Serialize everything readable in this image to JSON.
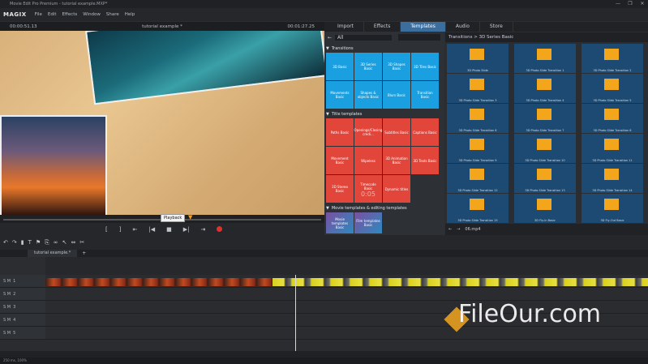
{
  "window": {
    "title": "Movie Edit Pro Premium - tutorial example.MXP*",
    "controls": [
      "—",
      "❐",
      "✕"
    ]
  },
  "menubar": {
    "logo": "MAGIX",
    "items": [
      "File",
      "Edit",
      "Effects",
      "Window",
      "Share",
      "Help"
    ]
  },
  "preview": {
    "timecode_left": "00:00:51.13",
    "title": "tutorial example *",
    "timecode_right": "00:01:27.25",
    "tooltip": "Playback"
  },
  "media_tabs": [
    "Import",
    "Effects",
    "Templates",
    "Audio",
    "Store"
  ],
  "active_tab": "Templates",
  "filter": {
    "value": "All"
  },
  "templates": {
    "transitions_header": "Transitions",
    "transitions": [
      "3D Basic",
      "3D Series Basic",
      "3D Shapes Basic",
      "3D Tiles Basic",
      "Movements Basic",
      "Shapes & objects Basic",
      "Blurs Basic",
      "Transition Basic"
    ],
    "titles_header": "Title templates",
    "titles": [
      "Paths Basic",
      "Openings/Closing credi...",
      "Subtitles Basic",
      "Captions Basic",
      "Movement Basic",
      "Wipeless",
      "3D Animation Basic",
      "3D Texts Basic",
      "3D Stereo Basic",
      "Timecode Basic",
      "Dynamic titles"
    ],
    "titles_timecode": "0:05",
    "movie_header": "Movie templates & editing templates",
    "movie": [
      "Movie templates Basic",
      "Film templates Basic"
    ]
  },
  "right_panel": {
    "header": "Transitions > 3D Series Basic",
    "thumbs": [
      "3D Photo Slide",
      "3D Photo Slide Transition 1",
      "3D Photo Slide Transition 2",
      "3D Photo Slide Transition 3",
      "3D Photo Slide Transition 4",
      "3D Photo Slide Transition 5",
      "3D Photo Slide Transition 6",
      "3D Photo Slide Transition 7",
      "3D Photo Slide Transition 8",
      "3D Photo Slide Transition 9",
      "3D Photo Slide Transition 10",
      "3D Photo Slide Transition 11",
      "3D Photo Slide Transition 12",
      "3D Photo Slide Transition 13",
      "3D Photo Slide Transition 14",
      "3D Photo Slide Transition 15",
      "3D Fly-In Basic",
      "3D Fly-Out Basic"
    ],
    "footer_count": "06.mp4"
  },
  "timeline": {
    "tab": "tutorial example.*",
    "tracks": [
      "1",
      "2",
      "3",
      "4",
      "5"
    ],
    "status": "250 ms, 100%"
  },
  "watermark": "FileOur.com"
}
